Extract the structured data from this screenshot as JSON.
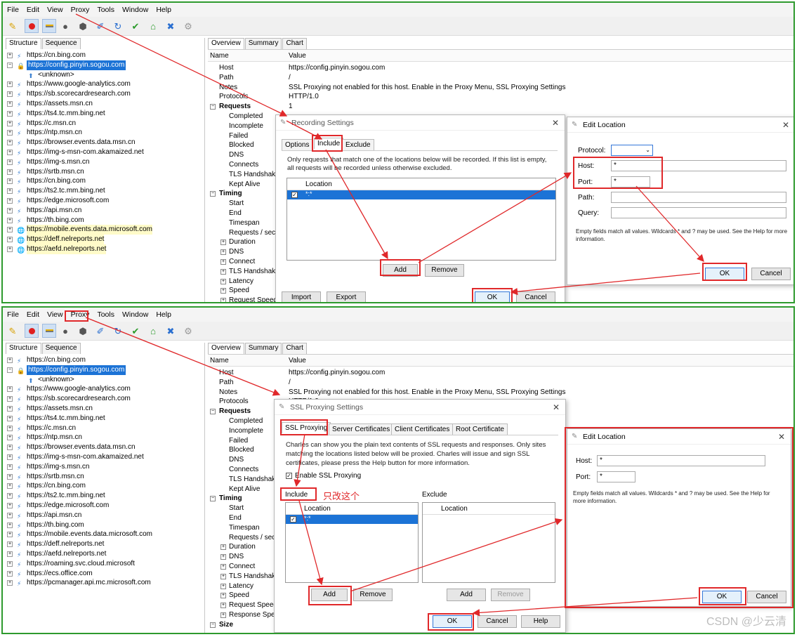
{
  "menu": [
    "File",
    "Edit",
    "View",
    "Proxy",
    "Tools",
    "Window",
    "Help"
  ],
  "toolbar_icons": [
    "broom-icon",
    "record-icon",
    "throttle-icon",
    "turtle-icon",
    "breakpoint-icon",
    "compose-icon",
    "refresh-icon",
    "validate-icon",
    "basket-icon",
    "tools-icon",
    "settings-gear-icon"
  ],
  "left_tabs": {
    "structure": "Structure",
    "sequence": "Sequence"
  },
  "right_tabs": {
    "overview": "Overview",
    "summary": "Summary",
    "chart": "Chart"
  },
  "columns": {
    "name": "Name",
    "value": "Value"
  },
  "top_tree": [
    {
      "label": "https://cn.bing.com"
    },
    {
      "label": "https://config.pinyin.sogou.com",
      "selected": true,
      "expanded": true
    },
    {
      "label": "<unknown>",
      "child": true
    },
    {
      "label": "https://www.google-analytics.com"
    },
    {
      "label": "https://sb.scorecardresearch.com"
    },
    {
      "label": "https://assets.msn.cn"
    },
    {
      "label": "https://ts4.tc.mm.bing.net"
    },
    {
      "label": "https://c.msn.cn"
    },
    {
      "label": "https://ntp.msn.cn"
    },
    {
      "label": "https://browser.events.data.msn.cn"
    },
    {
      "label": "https://img-s-msn-com.akamaized.net"
    },
    {
      "label": "https://img-s.msn.cn"
    },
    {
      "label": "https://srtb.msn.cn"
    },
    {
      "label": "https://cn.bing.com"
    },
    {
      "label": "https://ts2.tc.mm.bing.net"
    },
    {
      "label": "https://edge.microsoft.com"
    },
    {
      "label": "https://api.msn.cn"
    },
    {
      "label": "https://th.bing.com"
    },
    {
      "label": "https://mobile.events.data.microsoft.com",
      "hl": true
    },
    {
      "label": "https://deff.nelreports.net",
      "hl": true
    },
    {
      "label": "https://aefd.nelreports.net",
      "hl": true
    }
  ],
  "bottom_tree": [
    {
      "label": "https://cn.bing.com"
    },
    {
      "label": "https://config.pinyin.sogou.com",
      "selected": true,
      "expanded": true
    },
    {
      "label": "<unknown>",
      "child": true
    },
    {
      "label": "https://www.google-analytics.com"
    },
    {
      "label": "https://sb.scorecardresearch.com"
    },
    {
      "label": "https://assets.msn.cn"
    },
    {
      "label": "https://ts4.tc.mm.bing.net"
    },
    {
      "label": "https://c.msn.cn"
    },
    {
      "label": "https://ntp.msn.cn"
    },
    {
      "label": "https://browser.events.data.msn.cn"
    },
    {
      "label": "https://img-s-msn-com.akamaized.net"
    },
    {
      "label": "https://img-s.msn.cn"
    },
    {
      "label": "https://srtb.msn.cn"
    },
    {
      "label": "https://cn.bing.com"
    },
    {
      "label": "https://ts2.tc.mm.bing.net"
    },
    {
      "label": "https://edge.microsoft.com"
    },
    {
      "label": "https://api.msn.cn"
    },
    {
      "label": "https://th.bing.com"
    },
    {
      "label": "https://mobile.events.data.microsoft.com"
    },
    {
      "label": "https://deff.nelreports.net"
    },
    {
      "label": "https://aefd.nelreports.net"
    },
    {
      "label": "https://roaming.svc.cloud.microsoft"
    },
    {
      "label": "https://ecs.office.com"
    },
    {
      "label": "https://pcmanager.api.mc.microsoft.com"
    }
  ],
  "overview_top": [
    {
      "k": "Host",
      "v": "https://config.pinyin.sogou.com"
    },
    {
      "k": "Path",
      "v": "/"
    },
    {
      "k": "Notes",
      "v": "SSL Proxying not enabled for this host. Enable in the Proxy Menu, SSL Proxying Settings"
    },
    {
      "k": "Protocols",
      "v": "HTTP/1.0"
    },
    {
      "k": "Requests",
      "v": "1",
      "section": true
    },
    {
      "k": "Completed",
      "sub": true
    },
    {
      "k": "Incomplete",
      "sub": true
    },
    {
      "k": "Failed",
      "sub": true
    },
    {
      "k": "Blocked",
      "sub": true
    },
    {
      "k": "DNS",
      "sub": true
    },
    {
      "k": "Connects",
      "sub": true
    },
    {
      "k": "TLS Handshakes",
      "sub": true
    },
    {
      "k": "Kept Alive",
      "sub": true
    },
    {
      "k": "Timing",
      "section": true
    },
    {
      "k": "Start",
      "sub": true
    },
    {
      "k": "End",
      "sub": true
    },
    {
      "k": "Timespan",
      "sub": true
    },
    {
      "k": "Requests / sec",
      "sub": true
    },
    {
      "k": "Duration",
      "sub2": true
    },
    {
      "k": "DNS",
      "sub2": true
    },
    {
      "k": "Connect",
      "sub2": true
    },
    {
      "k": "TLS Handshake",
      "sub2": true
    },
    {
      "k": "Latency",
      "sub2": true
    },
    {
      "k": "Speed",
      "sub2": true
    },
    {
      "k": "Request Speed",
      "sub2": true
    }
  ],
  "overview_bottom": [
    {
      "k": "Host",
      "v": "https://config.pinyin.sogou.com"
    },
    {
      "k": "Path",
      "v": "/"
    },
    {
      "k": "Notes",
      "v": "SSL Proxying not enabled for this host. Enable in the Proxy Menu, SSL Proxying Settings"
    },
    {
      "k": "Protocols",
      "v": "HTTP/1.0"
    },
    {
      "k": "Requests",
      "section": true
    },
    {
      "k": "Completed",
      "sub": true
    },
    {
      "k": "Incomplete",
      "sub": true
    },
    {
      "k": "Failed",
      "sub": true
    },
    {
      "k": "Blocked",
      "sub": true
    },
    {
      "k": "DNS",
      "sub": true
    },
    {
      "k": "Connects",
      "sub": true
    },
    {
      "k": "TLS Handshake",
      "sub": true
    },
    {
      "k": "Kept Alive",
      "sub": true
    },
    {
      "k": "Timing",
      "section": true
    },
    {
      "k": "Start",
      "sub": true
    },
    {
      "k": "End",
      "sub": true
    },
    {
      "k": "Timespan",
      "sub": true
    },
    {
      "k": "Requests / sec",
      "sub": true
    },
    {
      "k": "Duration",
      "sub2": true
    },
    {
      "k": "DNS",
      "sub2": true
    },
    {
      "k": "Connect",
      "sub2": true
    },
    {
      "k": "TLS Handshake",
      "sub2": true
    },
    {
      "k": "Latency",
      "sub2": true
    },
    {
      "k": "Speed",
      "sub2": true
    },
    {
      "k": "Request Speed",
      "sub2": true
    },
    {
      "k": "Response Speed",
      "sub2": true
    },
    {
      "k": "Size",
      "section": true
    }
  ],
  "recording_dialog": {
    "title": "Recording Settings",
    "tabs": [
      "Options",
      "Include",
      "Exclude"
    ],
    "description": "Only requests that match one of the locations below will be recorded. If this list is empty, all requests will be recorded unless otherwise excluded.",
    "column": "Location",
    "row": "*:*",
    "add": "Add",
    "remove": "Remove",
    "import": "Import",
    "export": "Export",
    "ok": "OK",
    "cancel": "Cancel"
  },
  "edit_location_top": {
    "title": "Edit Location",
    "protocol_label": "Protocol:",
    "host_label": "Host:",
    "host_value": "*",
    "port_label": "Port:",
    "port_value": "*",
    "path_label": "Path:",
    "query_label": "Query:",
    "note": "Empty fields match all values. Wildcards * and ? may be used. See the Help for more information.",
    "ok": "OK",
    "cancel": "Cancel"
  },
  "ssl_dialog": {
    "title": "SSL Proxying Settings",
    "tabs": [
      "SSL Proxying",
      "Server Certificates",
      "Client Certificates",
      "Root Certificate"
    ],
    "description": "Charles can show you the plain text contents of SSL requests and responses. Only sites matching the locations listed below will be proxied. Charles will issue and sign SSL certificates, please press the Help button for more information.",
    "enable": "Enable SSL Proxying",
    "include": "Include",
    "exclude": "Exclude",
    "column": "Location",
    "row": "*:*",
    "add": "Add",
    "remove": "Remove",
    "ok": "OK",
    "cancel": "Cancel",
    "help": "Help"
  },
  "edit_location_bottom": {
    "title": "Edit Location",
    "host_label": "Host:",
    "host_value": "*",
    "port_label": "Port:",
    "port_value": "*",
    "note": "Empty fields match all values. Wildcards * and ? may be used. See the Help for more information.",
    "ok": "OK",
    "cancel": "Cancel"
  },
  "annotation": "只改这个",
  "watermark": "CSDN @少云清",
  "colors": {
    "annotation_red": "#e0282a",
    "panel_border": "#2e9a2e",
    "selection": "#1c73d6"
  }
}
